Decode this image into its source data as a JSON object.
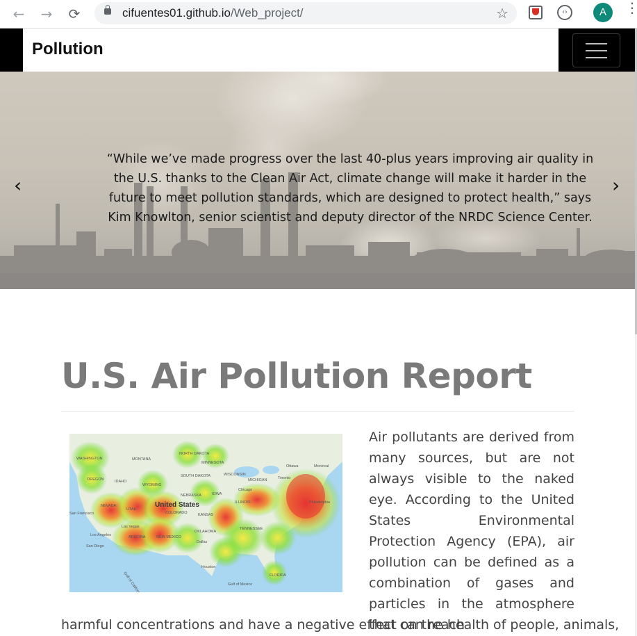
{
  "browser": {
    "url_host": "cifuentes01.github.io",
    "url_path": "/Web_project/",
    "avatar_letter": "A"
  },
  "navbar": {
    "brand": "Pollution"
  },
  "carousel": {
    "quote": "“While we’ve made progress over the last 40-plus years improving air quality in the U.S. thanks to the Clean Air Act, climate change will make it harder in the future to meet pollution standards, which are designed to protect health,” says Kim Knowlton, senior scientist and deputy director of the NRDC Science Center.",
    "prev": "‹",
    "next": "›"
  },
  "main": {
    "title": "U.S. Air Pollution Report",
    "paragraph_wrapped": "Air pollutants are derived from many sources, but are not always visible to the naked eye. According to the United States Environmental Protection Agency (EPA), air pollution can be defined as a combination of gases and particles in the atmosphere that can reach",
    "paragraph_full": "harmful concentrations and have a negative effect on the health of people, animals,"
  },
  "map": {
    "labels": [
      "WASHINGTON",
      "MONTANA",
      "NORTH DAKOTA",
      "MINNESOTA",
      "OREGON",
      "IDAHO",
      "SOUTH DAKOTA",
      "WISCONSIN",
      "MICHIGAN",
      "Ottawa",
      "Montreal",
      "Toronto",
      "WYOMING",
      "NEBRASKA",
      "IOWA",
      "Chicago",
      "NEVADA",
      "United States",
      "ILLINOIS",
      "Philadelphia",
      "San Francisco",
      "UTAH",
      "COLORADO",
      "KANSAS",
      "Las Vegas",
      "TENNESSEE",
      "Los Angeles",
      "ARIZONA",
      "NEW MEXICO",
      "OKLAHOMA",
      "San Diego",
      "Dallas",
      "Houston",
      "Gulf of Mexico",
      "FLORIDA",
      "Gulf of California"
    ]
  },
  "colors": {
    "navbar_bg": "#000000",
    "title_gray": "#7a7a7a",
    "heat_red": "#e53030",
    "heat_green": "#6fdc3a"
  }
}
